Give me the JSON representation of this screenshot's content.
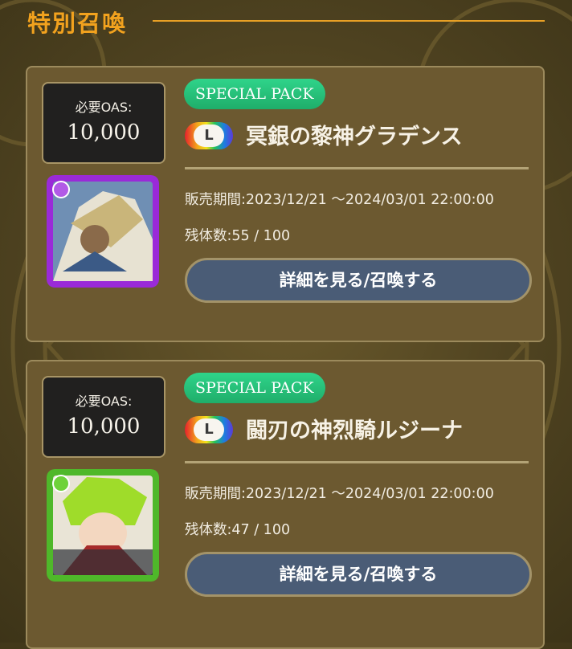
{
  "header": {
    "title": "特別召喚"
  },
  "packs": [
    {
      "cost_label": "必要OAS:",
      "cost_value": "10,000",
      "badge": "SPECIAL PACK",
      "rarity": "L",
      "name": "冥銀の黎神グラデンス",
      "period": "販売期間:2023/12/21 〜2024/03/01 22:00:00",
      "remaining": "残体数:55 / 100",
      "button": "詳細を見る/召喚する",
      "frame_color": "#9a2ad8",
      "portrait_icon": "character-portrait-purple"
    },
    {
      "cost_label": "必要OAS:",
      "cost_value": "10,000",
      "badge": "SPECIAL PACK",
      "rarity": "L",
      "name": "闘刃の神烈騎ルジーナ",
      "period": "販売期間:2023/12/21 〜2024/03/01 22:00:00",
      "remaining": "残体数:47 / 100",
      "button": "詳細を見る/召喚する",
      "frame_color": "#4fb82a",
      "portrait_icon": "character-portrait-green"
    }
  ]
}
